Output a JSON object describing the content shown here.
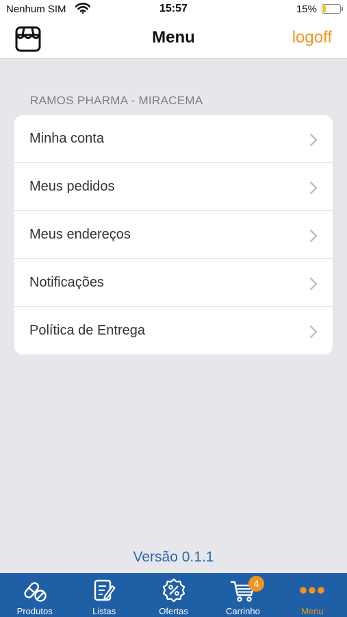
{
  "status_bar": {
    "carrier": "Nenhum SIM",
    "time": "15:57",
    "battery_percent": "15%",
    "battery_level": 0.15,
    "battery_color": "#f2c400"
  },
  "nav_bar": {
    "left_icon": "store-icon",
    "title": "Menu",
    "logoff_label": "logoff",
    "accent_color": "#f0941f"
  },
  "section": {
    "header": "RAMOS PHARMA - MIRACEMA",
    "items": [
      {
        "label": "Minha conta"
      },
      {
        "label": "Meus pedidos"
      },
      {
        "label": "Meus endereços"
      },
      {
        "label": "Notificações"
      },
      {
        "label": "Política de Entrega"
      }
    ]
  },
  "version": "Versão 0.1.1",
  "tab_bar": {
    "background": "#1f5fa6",
    "tabs": [
      {
        "label": "Produtos",
        "icon": "pills-icon"
      },
      {
        "label": "Listas",
        "icon": "list-edit-icon"
      },
      {
        "label": "Ofertas",
        "icon": "discount-badge-icon"
      },
      {
        "label": "Carrinho",
        "icon": "cart-icon",
        "badge": "4"
      },
      {
        "label": "Menu",
        "icon": "more-dots-icon",
        "active": true
      }
    ]
  }
}
